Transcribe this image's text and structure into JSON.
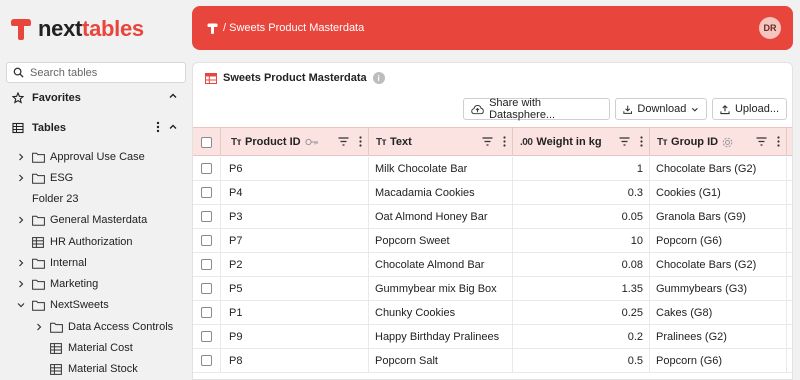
{
  "brand": {
    "part1": "next",
    "part2": "tables"
  },
  "search": {
    "placeholder": "Search tables"
  },
  "sidebar": {
    "favorites_label": "Favorites",
    "tables_label": "Tables",
    "items": [
      {
        "label": "Approval Use Case",
        "type": "folder",
        "expanded": false
      },
      {
        "label": "ESG",
        "type": "folder",
        "expanded": false
      },
      {
        "label": "Folder 23",
        "type": "folder",
        "expanded": false
      },
      {
        "label": "General Masterdata",
        "type": "folder",
        "expanded": false
      },
      {
        "label": "HR Authorization",
        "type": "table"
      },
      {
        "label": "Internal",
        "type": "folder",
        "expanded": false
      },
      {
        "label": "Marketing",
        "type": "folder",
        "expanded": false
      },
      {
        "label": "NextSweets",
        "type": "folder",
        "expanded": true
      },
      {
        "label": "Data Access Controls",
        "type": "folder",
        "expanded": false
      },
      {
        "label": "Material Cost",
        "type": "table"
      },
      {
        "label": "Material Stock",
        "type": "table"
      }
    ]
  },
  "header": {
    "breadcrumb": "/ Sweets Product Masterdata",
    "avatar_initials": "DR",
    "accent": "#e8453c"
  },
  "panel": {
    "title": "Sweets Product Masterdata",
    "info_glyph": "i",
    "buttons": {
      "share": "Share with Datasphere...",
      "download": "Download",
      "upload": "Upload..."
    }
  },
  "table": {
    "columns": [
      {
        "label": "Product ID",
        "type_glyph": "Tт"
      },
      {
        "label": "Text",
        "type_glyph": "Tт"
      },
      {
        "label": "Weight in kg",
        "type_glyph": ".00"
      },
      {
        "label": "Group ID",
        "type_glyph": "Tт"
      }
    ],
    "rows": [
      {
        "id": "P6",
        "text": "Milk Chocolate Bar",
        "weight": "1",
        "group": "Chocolate Bars (G2)"
      },
      {
        "id": "P4",
        "text": "Macadamia Cookies",
        "weight": "0.3",
        "group": "Cookies (G1)"
      },
      {
        "id": "P3",
        "text": "Oat Almond Honey Bar",
        "weight": "0.05",
        "group": "Granola Bars (G9)"
      },
      {
        "id": "P7",
        "text": "Popcorn Sweet",
        "weight": "10",
        "group": "Popcorn (G6)"
      },
      {
        "id": "P2",
        "text": "Chocolate Almond Bar",
        "weight": "0.08",
        "group": "Chocolate Bars (G2)"
      },
      {
        "id": "P5",
        "text": "Gummybear mix Big Box",
        "weight": "1.35",
        "group": "Gummybears (G3)"
      },
      {
        "id": "P1",
        "text": "Chunky Cookies",
        "weight": "0.25",
        "group": "Cakes (G8)"
      },
      {
        "id": "P9",
        "text": "Happy Birthday Pralinees",
        "weight": "0.2",
        "group": "Pralinees (G2)"
      },
      {
        "id": "P8",
        "text": "Popcorn Salt",
        "weight": "0.5",
        "group": "Popcorn (G6)"
      }
    ]
  }
}
